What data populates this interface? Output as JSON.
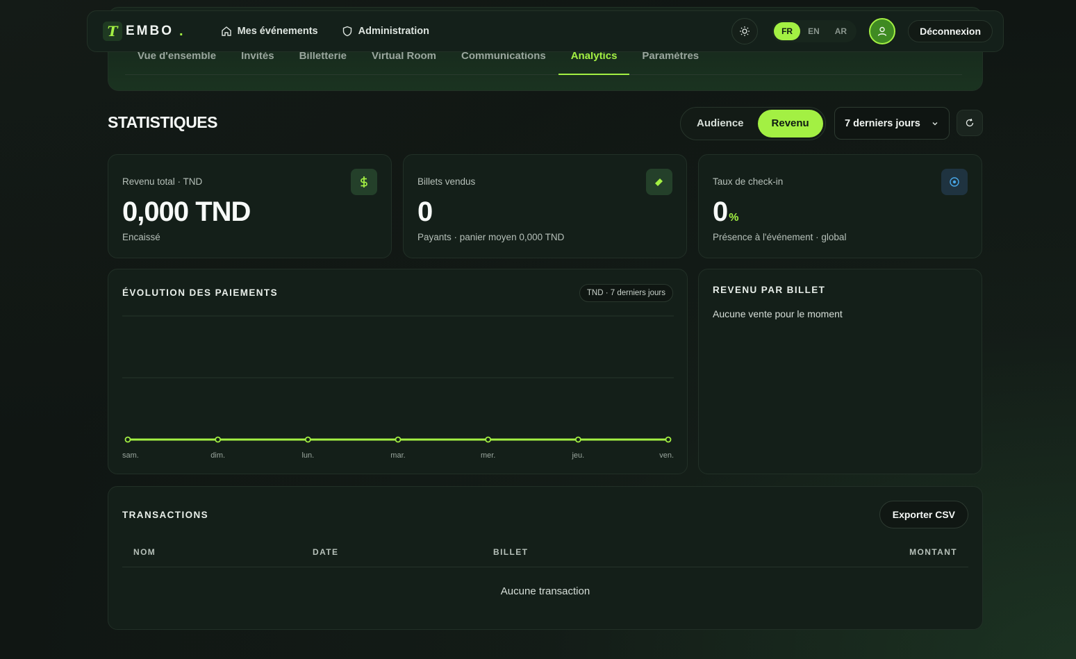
{
  "brand": {
    "name": "EMBO",
    "dot": ".",
    "mark": "T"
  },
  "nav": {
    "events_label": "Mes événements",
    "admin_label": "Administration",
    "languages": [
      "FR",
      "EN",
      "AR"
    ],
    "active_language": "FR",
    "logout_label": "Déconnexion"
  },
  "tabs": [
    "Vue d'ensemble",
    "Invités",
    "Billetterie",
    "Virtual Room",
    "Communications",
    "Analytics",
    "Paramètres"
  ],
  "active_tab": "Analytics",
  "stats": {
    "title": "STATISTIQUES",
    "segments": [
      "Audience",
      "Revenu"
    ],
    "active_segment": "Revenu",
    "range_label": "7 derniers jours"
  },
  "kpis": {
    "revenue": {
      "label": "Revenu total · TND",
      "value": "0,000 TND",
      "sub": "Encaissé",
      "icon": "dollar-icon"
    },
    "tickets": {
      "label": "Billets vendus",
      "value": "0",
      "sub": "Payants · panier moyen 0,000 TND",
      "icon": "ticket-icon"
    },
    "checkin": {
      "label": "Taux de check-in",
      "value": "0",
      "unit": "%",
      "sub": "Présence à l'événement · global",
      "icon": "target-icon"
    }
  },
  "payments_chart": {
    "title": "ÉVOLUTION DES PAIEMENTS",
    "badge": "TND · 7 derniers jours"
  },
  "chart_data": {
    "type": "line",
    "categories": [
      "sam.",
      "dim.",
      "lun.",
      "mar.",
      "mer.",
      "jeu.",
      "ven."
    ],
    "values": [
      0,
      0,
      0,
      0,
      0,
      0,
      0
    ],
    "grid": true,
    "color": "#a3f043"
  },
  "revenue_per_ticket": {
    "title": "REVENU PAR BILLET",
    "empty": "Aucune vente pour le moment"
  },
  "transactions": {
    "title": "TRANSACTIONS",
    "export_label": "Exporter CSV",
    "columns": [
      "NOM",
      "DATE",
      "BILLET",
      "MONTANT"
    ],
    "empty": "Aucune transaction"
  },
  "colors": {
    "accent": "#a3f043",
    "background": "#121815",
    "card": "#141f19"
  }
}
